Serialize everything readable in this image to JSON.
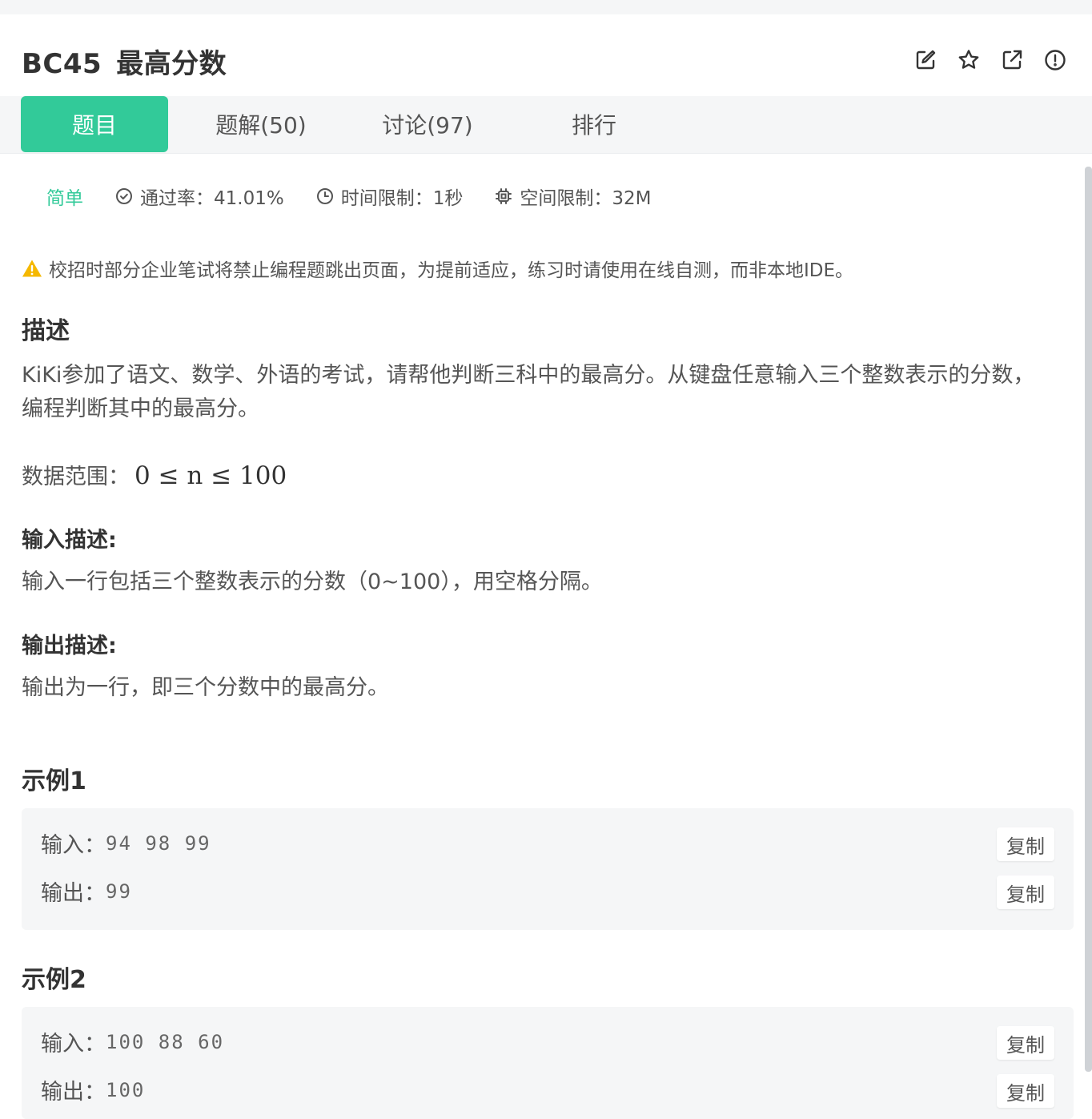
{
  "problem": {
    "id": "BC45",
    "name": "最高分数"
  },
  "actions": [
    {
      "icon": "edit-icon"
    },
    {
      "icon": "star-icon"
    },
    {
      "icon": "external-link-icon"
    },
    {
      "icon": "report-icon"
    }
  ],
  "tabs": [
    {
      "label": "题目",
      "active": true
    },
    {
      "label": "题解(50)"
    },
    {
      "label": "讨论(97)"
    },
    {
      "label": "排行"
    }
  ],
  "meta": {
    "difficulty": "简单",
    "pass_rate": "通过率：41.01%",
    "time_limit": "时间限制：1秒",
    "memory_limit": "空间限制：32M"
  },
  "notice": "校招时部分企业笔试将禁止编程题跳出页面，为提前适应，练习时请使用在线自测，而非本地IDE。",
  "description": {
    "heading": "描述",
    "line1": "KiKi参加了语文、数学、外语的考试，请帮他判断三科中的最高分。从键盘任意输入三个整数表示的分数，",
    "line2": "编程判断其中的最高分。",
    "range_label": "数据范围：",
    "range_math": "0 ≤ n ≤ 100"
  },
  "input_desc": {
    "heading": "输入描述:",
    "text": "输入一行包括三个整数表示的分数（0~100），用空格分隔。"
  },
  "output_desc": {
    "heading": "输出描述:",
    "text": "输出为一行，即三个分数中的最高分。"
  },
  "examples": [
    {
      "heading": "示例1",
      "input_label": "输入：",
      "input_value": "94 98 99",
      "output_label": "输出：",
      "output_value": "99",
      "copy_label": "复制"
    },
    {
      "heading": "示例2",
      "input_label": "输入：",
      "input_value": "100 88 60",
      "output_label": "输出：",
      "output_value": "100",
      "copy_label": "复制"
    }
  ],
  "colors": {
    "accent": "#32ca99",
    "warning": "#f5b800"
  }
}
